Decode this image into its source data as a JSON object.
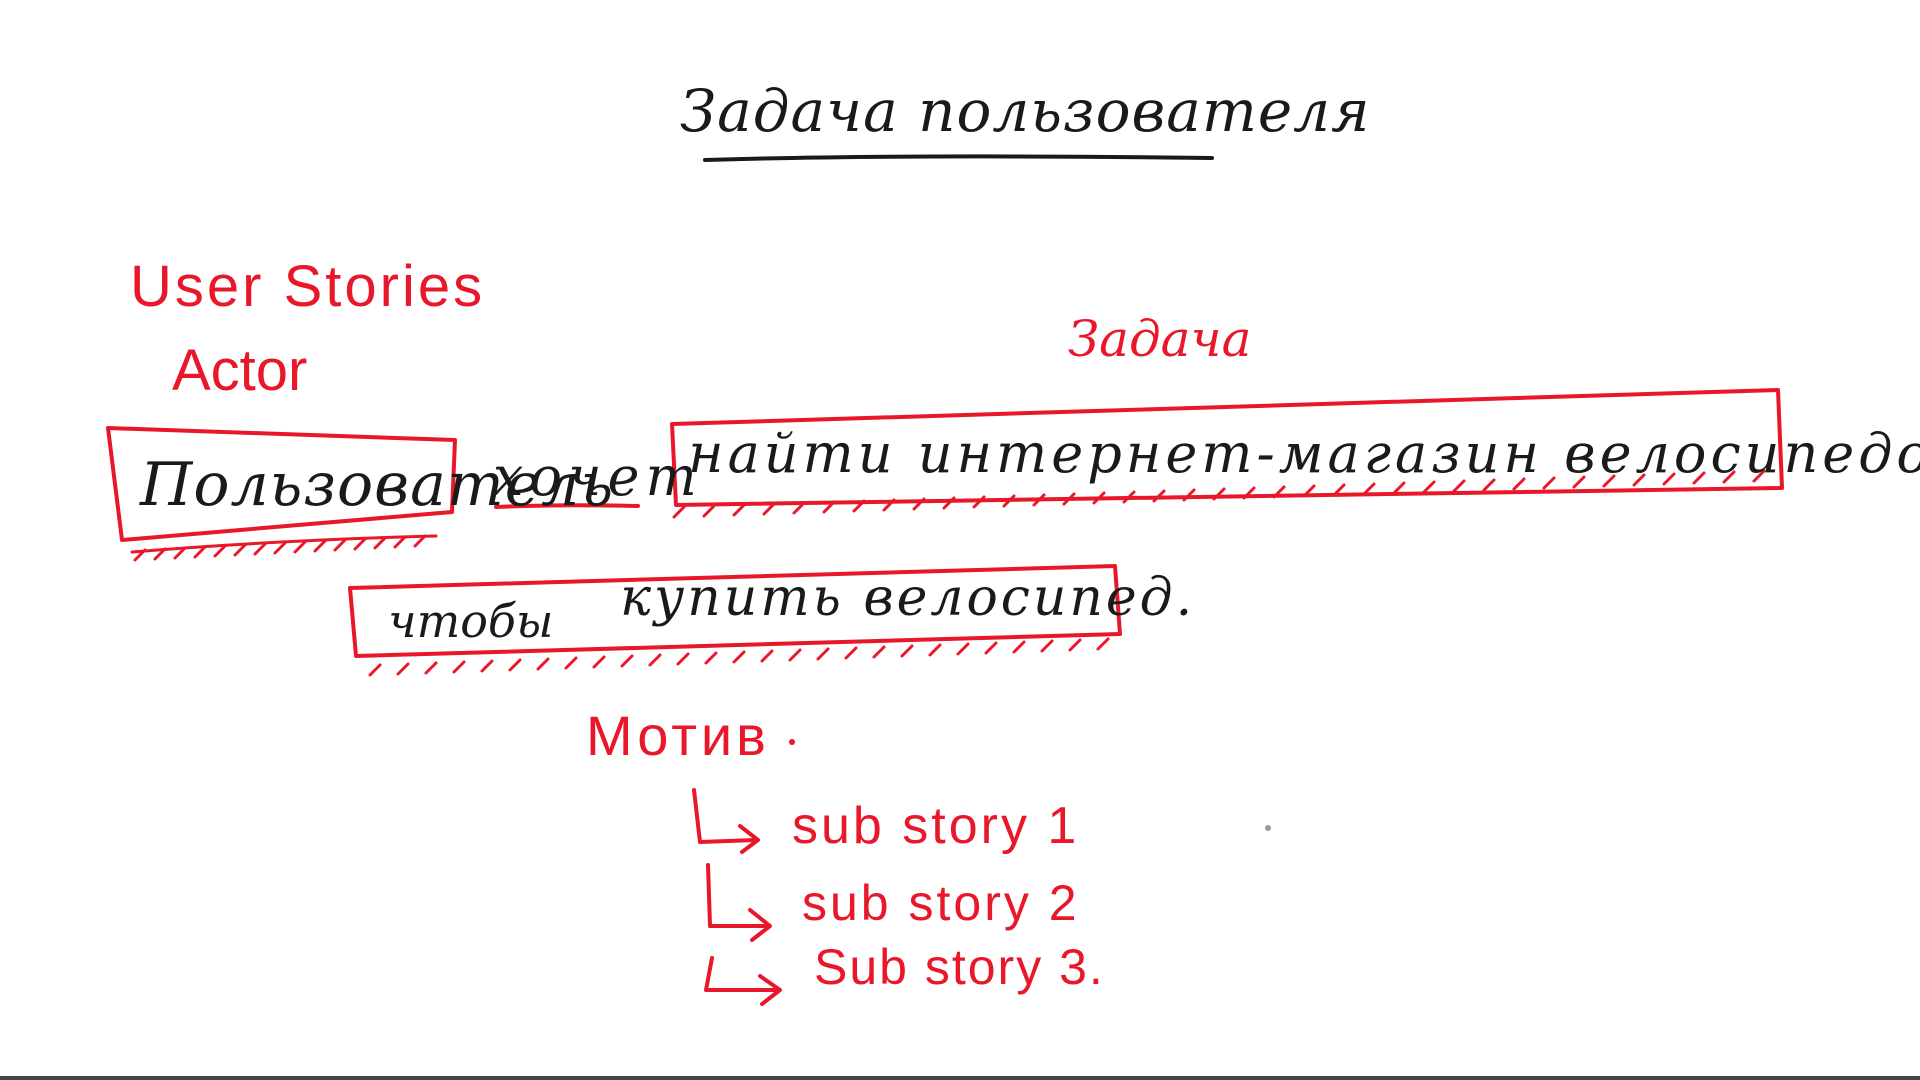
{
  "title": "Задача пользователя",
  "labels": {
    "user_stories": "User Stories",
    "actor": "Actor",
    "task": "Задача",
    "motive": "Мотив"
  },
  "story": {
    "actor_word": "Пользователь",
    "wants_word": "хочет",
    "task_text": "найти интернет-магазин велосипедов,",
    "motive_prefix": "чтобы",
    "motive_text": "купить велосипед."
  },
  "sub_stories": [
    "sub story 1",
    "sub story 2",
    "Sub story 3."
  ],
  "colors": {
    "ink_red": "#e8182a",
    "ink_black": "#1a1a1a",
    "background": "#ffffff"
  }
}
